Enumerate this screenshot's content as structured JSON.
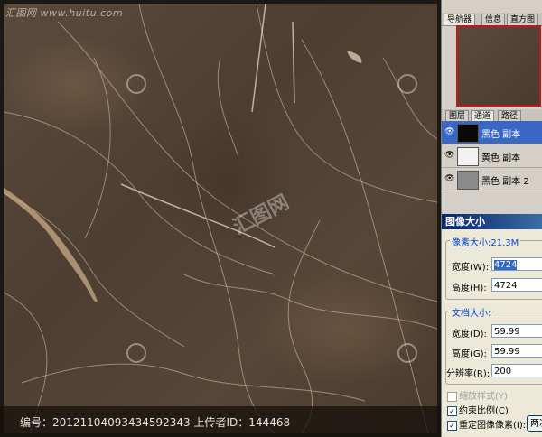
{
  "watermark": {
    "site": "汇图网 www.huitu.com",
    "center": "汇图网"
  },
  "caption": "编号：20121104093434592343 上传者ID：144468",
  "panel": {
    "nav_tabs": [
      "导航器",
      "信息",
      "直方图"
    ],
    "layer_tabs": [
      "图层",
      "通道",
      "路径"
    ],
    "channels": [
      {
        "label": "黑色 副本",
        "selected": true
      },
      {
        "label": "黄色 副本",
        "selected": false
      },
      {
        "label": "黑色 副本 2",
        "selected": false
      }
    ]
  },
  "dialog": {
    "title": "图像大小",
    "pixel_dim_title": "像素大小:21.3M",
    "width_label": "宽度(W):",
    "width_value": "4724",
    "height_label": "高度(H):",
    "height_value": "4724",
    "doc_size_title": "文档大小:",
    "doc_width_label": "宽度(D):",
    "doc_width_value": "59.99",
    "doc_height_label": "高度(G):",
    "doc_height_value": "59.99",
    "resolution_label": "分辨率(R):",
    "resolution_value": "200",
    "scale_styles": "缩放样式(Y)",
    "constrain": "约束比例(C)",
    "resample": "重定图像像素(I):",
    "resample_value": "两次"
  }
}
